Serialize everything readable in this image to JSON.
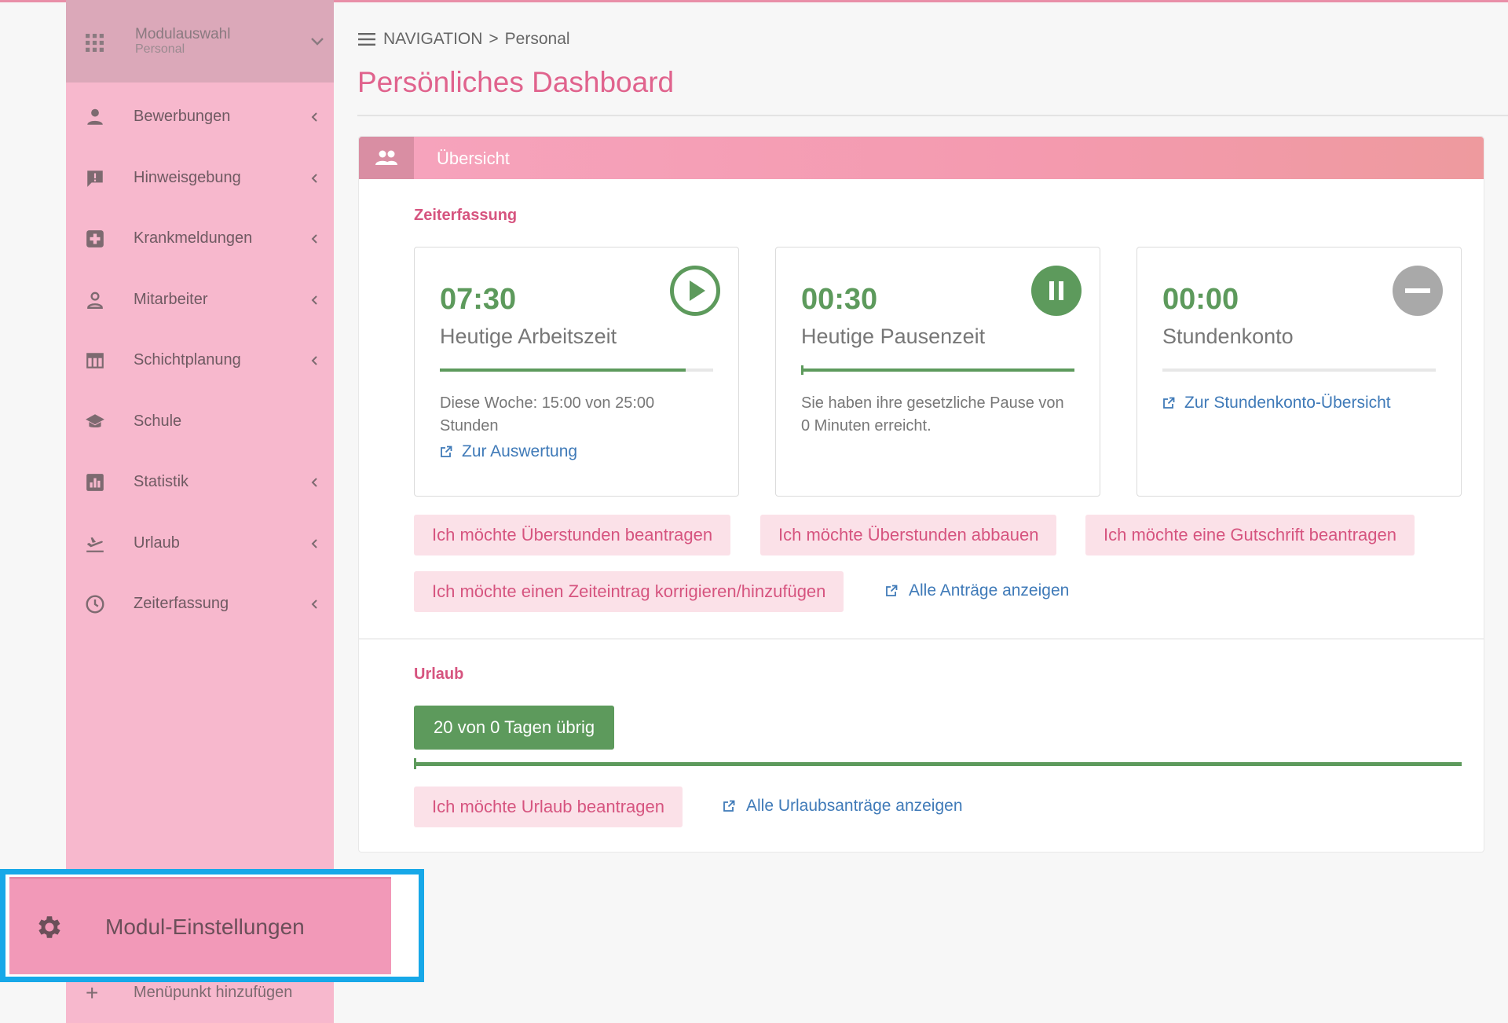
{
  "sidebar": {
    "module_select": {
      "title": "Modulauswahl",
      "subtitle": "Personal"
    },
    "items": [
      {
        "label": "Bewerbungen",
        "icon": "person-icon",
        "has_chevron": true
      },
      {
        "label": "Hinweisgebung",
        "icon": "feedback-icon",
        "has_chevron": true
      },
      {
        "label": "Krankmeldungen",
        "icon": "medical-icon",
        "has_chevron": true
      },
      {
        "label": "Mitarbeiter",
        "icon": "person-outline-icon",
        "has_chevron": true
      },
      {
        "label": "Schichtplanung",
        "icon": "calendar-table-icon",
        "has_chevron": true
      },
      {
        "label": "Schule",
        "icon": "graduation-cap-icon",
        "has_chevron": false
      },
      {
        "label": "Statistik",
        "icon": "bar-chart-icon",
        "has_chevron": true
      },
      {
        "label": "Urlaub",
        "icon": "airplane-icon",
        "has_chevron": true
      },
      {
        "label": "Zeiterfassung",
        "icon": "clock-icon",
        "has_chevron": true
      }
    ],
    "module_settings": "Modul-Einstellungen",
    "add_menu_item": "Menüpunkt hinzufügen"
  },
  "breadcrumb": {
    "root": "NAVIGATION",
    "separator": ">",
    "current": "Personal"
  },
  "page_title": "Persönliches Dashboard",
  "panel": {
    "title": "Übersicht",
    "time_section": "Zeiterfassung",
    "cards": [
      {
        "value": "07:30",
        "label": "Heutige Arbeitszeit",
        "progress": 0.9,
        "desc": "Diese Woche: 15:00 von 25:00 Stunden",
        "link": "Zur Auswertung",
        "icon": "play-icon"
      },
      {
        "value": "00:30",
        "label": "Heutige Pausenzeit",
        "progress": 1.0,
        "desc": "Sie haben ihre gesetzliche Pause von 0 Minuten erreicht.",
        "link": "",
        "icon": "pause-icon"
      },
      {
        "value": "00:00",
        "label": "Stundenkonto",
        "progress": 0,
        "desc": "",
        "link": "Zur Stundenkonto-Übersicht",
        "icon": "minus-icon"
      }
    ],
    "actions": {
      "overtime_request": "Ich möchte Überstunden beantragen",
      "overtime_reduce": "Ich möchte Überstunden abbauen",
      "credit_request": "Ich möchte eine Gutschrift beantragen",
      "correct_entry": "Ich möchte einen Zeiteintrag korrigieren/hinzufügen",
      "all_requests": "Alle Anträge anzeigen"
    },
    "vacation_section": "Urlaub",
    "vacation_badge": "20 von 0 Tagen übrig",
    "vacation_progress": 1.0,
    "vacation_request": "Ich möchte Urlaub beantragen",
    "all_vacation_requests": "Alle Urlaubsanträge anzeigen"
  },
  "colors": {
    "sidebar_bg": "#f7b8cd",
    "accent_pink": "#e0638d",
    "green": "#5d9a5c",
    "link_blue": "#3f7ab8",
    "highlight_border": "#17a8e8"
  }
}
